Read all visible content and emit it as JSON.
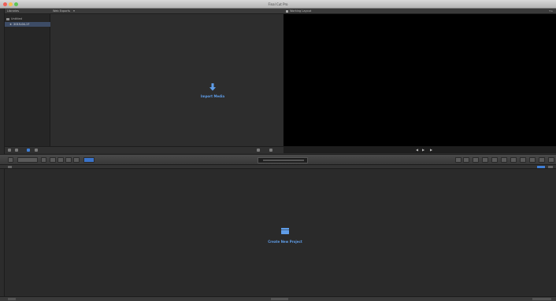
{
  "window": {
    "title": "Final Cut Pro",
    "traffic_lights": [
      "#ed5f57",
      "#f5bd4f",
      "#5ec454"
    ]
  },
  "libraries": {
    "header": "Libraries",
    "items": [
      {
        "label": "Untitled",
        "icon": "library-icon"
      },
      {
        "label": "2015-04-17",
        "icon": "event-star-icon",
        "selected": true
      }
    ]
  },
  "browser": {
    "header": "Web Exports",
    "import_label": "Import Media",
    "icon": "import-arrow-icon"
  },
  "viewer": {
    "header": "Working Layout"
  },
  "timeline": {
    "create_label": "Create New Project",
    "icon": "clapper-icon"
  },
  "colors": {
    "accent": "#5f9de8",
    "selection": "#3d4c66",
    "panel": "#2b2b2b",
    "viewer_bg": "#000000"
  }
}
